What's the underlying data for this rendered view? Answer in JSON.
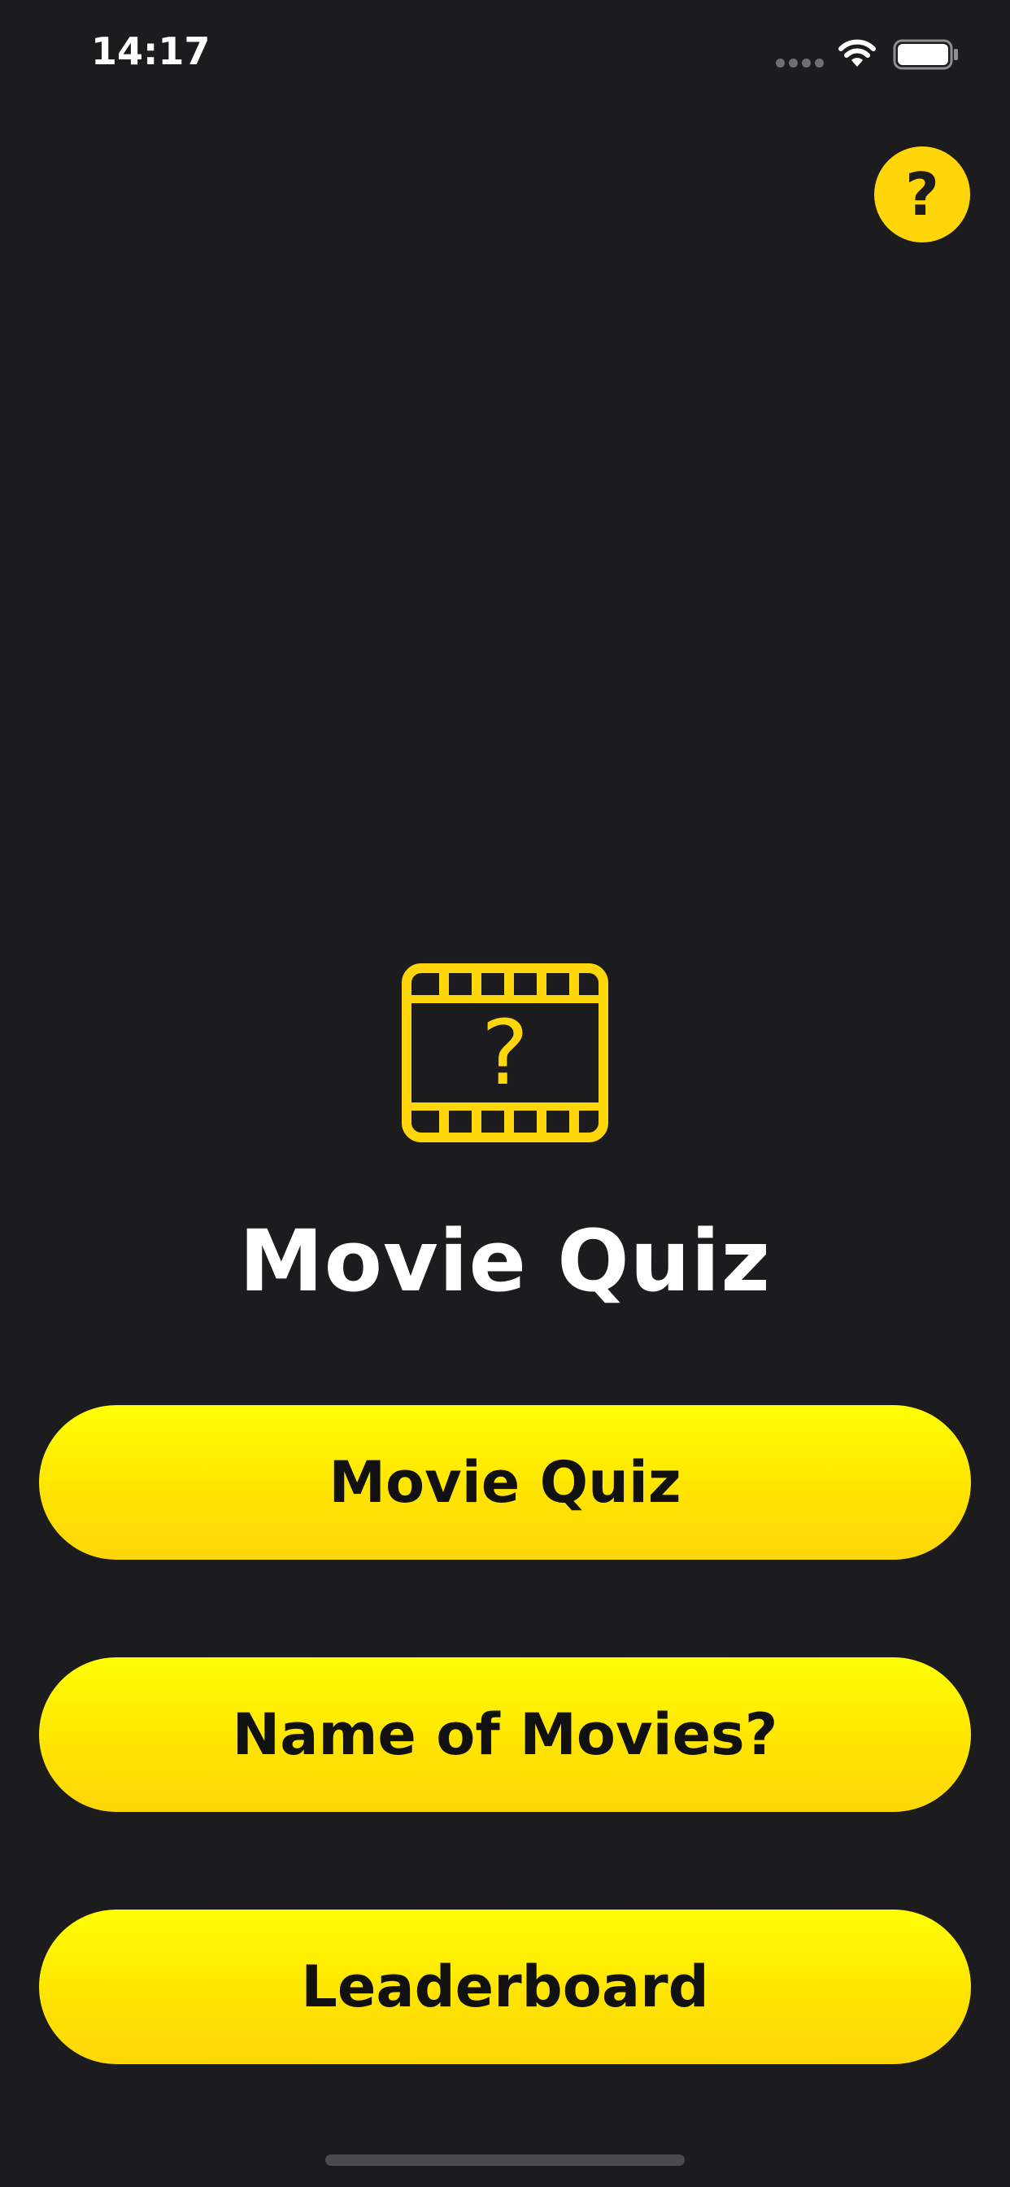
{
  "status_bar": {
    "time": "14:17",
    "icons": [
      "signal-dots-icon",
      "wifi-icon",
      "battery-icon"
    ]
  },
  "help_button": {
    "label": "?",
    "icon": "question-mark-icon"
  },
  "logo": {
    "icon": "film-strip-question-icon",
    "glyph": "?"
  },
  "title": "Movie Quiz",
  "menu": {
    "items": [
      {
        "label": "Movie Quiz"
      },
      {
        "label": "Name of Movies?"
      },
      {
        "label": "Leaderboard"
      }
    ]
  },
  "colors": {
    "background": "#1c1c1e",
    "accent": "#ffd60a",
    "button_top": "#ffff05",
    "button_bottom": "#ffd60a",
    "button_text": "#111111",
    "title_text": "#ffffff"
  }
}
